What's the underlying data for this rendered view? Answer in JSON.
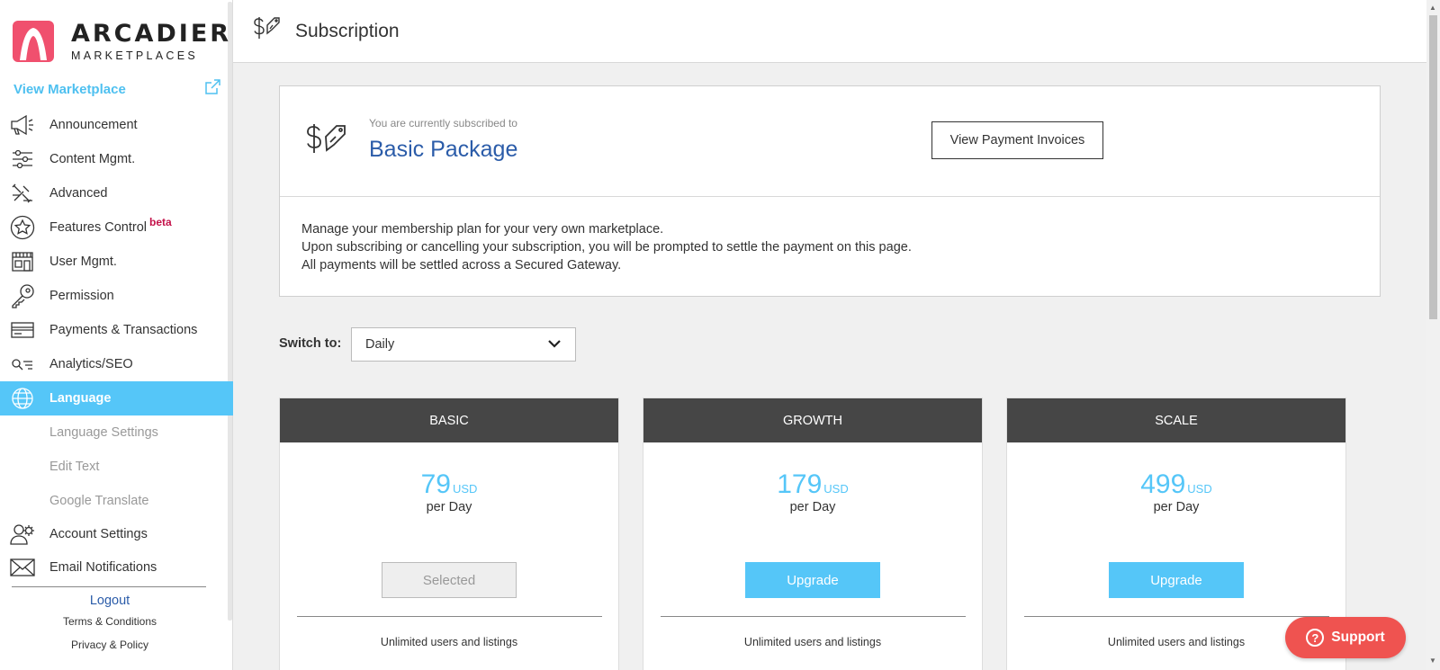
{
  "brand": {
    "title": "ARCADIER",
    "subtitle": "MARKETPLACES",
    "color": "#f0506e"
  },
  "sidebar": {
    "view_marketplace": "View Marketplace",
    "items": [
      {
        "label": "Announcement",
        "icon": "megaphone-icon"
      },
      {
        "label": "Content Mgmt.",
        "icon": "sliders-icon"
      },
      {
        "label": "Advanced",
        "icon": "tools-icon"
      },
      {
        "label": "Features Control",
        "icon": "star-icon",
        "badge": "beta"
      },
      {
        "label": "User Mgmt.",
        "icon": "store-icon"
      },
      {
        "label": "Permission",
        "icon": "key-icon"
      },
      {
        "label": "Payments & Transactions",
        "icon": "card-icon"
      },
      {
        "label": "Analytics/SEO",
        "icon": "analytics-icon"
      },
      {
        "label": "Language",
        "icon": "globe-icon",
        "active": true
      }
    ],
    "sub_items": [
      "Language Settings",
      "Edit Text",
      "Google Translate"
    ],
    "items_after": [
      {
        "label": "Account Settings",
        "icon": "users-gear-icon"
      },
      {
        "label": "Email Notifications",
        "icon": "envelope-icon"
      }
    ],
    "logout": "Logout",
    "terms": "Terms & Conditions",
    "privacy": "Privacy & Policy"
  },
  "header": {
    "title": "Subscription"
  },
  "subscription": {
    "caption": "You are currently subscribed to",
    "plan_name": "Basic Package",
    "invoices_button": "View Payment Invoices",
    "description": [
      "Manage your membership plan for your very own marketplace.",
      "Upon subscribing or cancelling your subscription, you will be prompted to settle the payment on this page.",
      "All payments will be settled across a Secured Gateway."
    ]
  },
  "switch": {
    "label": "Switch to:",
    "value": "Daily"
  },
  "plans": [
    {
      "name": "BASIC",
      "price": "79",
      "currency": "USD",
      "period": "per Day",
      "button": "Selected",
      "feature": "Unlimited users and listings"
    },
    {
      "name": "GROWTH",
      "price": "179",
      "currency": "USD",
      "period": "per Day",
      "button": "Upgrade",
      "feature": "Unlimited users and listings"
    },
    {
      "name": "SCALE",
      "price": "499",
      "currency": "USD",
      "period": "per Day",
      "button": "Upgrade",
      "feature": "Unlimited users and listings"
    }
  ],
  "support": {
    "label": "Support"
  },
  "colors": {
    "accent": "#55c6f8",
    "plan_header": "#464646",
    "support": "#ef5350",
    "link": "#2b5ca9",
    "beta": "#c4124a"
  }
}
